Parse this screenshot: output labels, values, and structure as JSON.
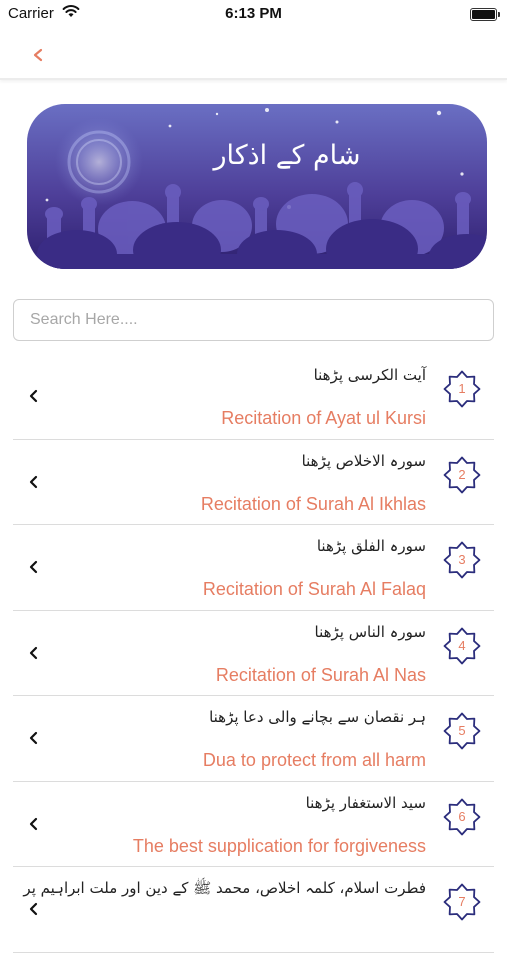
{
  "status_bar": {
    "carrier": "Carrier",
    "time": "6:13 PM"
  },
  "banner": {
    "title": "شام کے اذکار"
  },
  "search": {
    "placeholder": "Search Here...."
  },
  "colors": {
    "accent": "#e67d62",
    "badge_outline": "#2b2d7c",
    "banner_top": "#5d58b7",
    "banner_bottom": "#2a1d6b"
  },
  "items": [
    {
      "number": "1",
      "urdu": "آیت الکرسی پڑھنا",
      "english": "Recitation of Ayat ul Kursi"
    },
    {
      "number": "2",
      "urdu": "سورہ الاخلاص پڑھنا",
      "english": "Recitation of Surah Al Ikhlas"
    },
    {
      "number": "3",
      "urdu": "سورہ الفلق پڑھنا",
      "english": "Recitation of Surah Al Falaq"
    },
    {
      "number": "4",
      "urdu": "سورہ الناس پڑھنا",
      "english": "Recitation of Surah Al Nas"
    },
    {
      "number": "5",
      "urdu": "ہر نقصان سے بچانے والی دعا پڑھنا",
      "english": "Dua to protect from all harm"
    },
    {
      "number": "6",
      "urdu": "سید الاستغفار پڑھنا",
      "english": "The best supplication for forgiveness"
    },
    {
      "number": "7",
      "urdu": "فطرت اسلام، کلمہ اخلاص، محمد ﷺ کے دین اور ملت ابراہیم پر",
      "english": ""
    }
  ]
}
